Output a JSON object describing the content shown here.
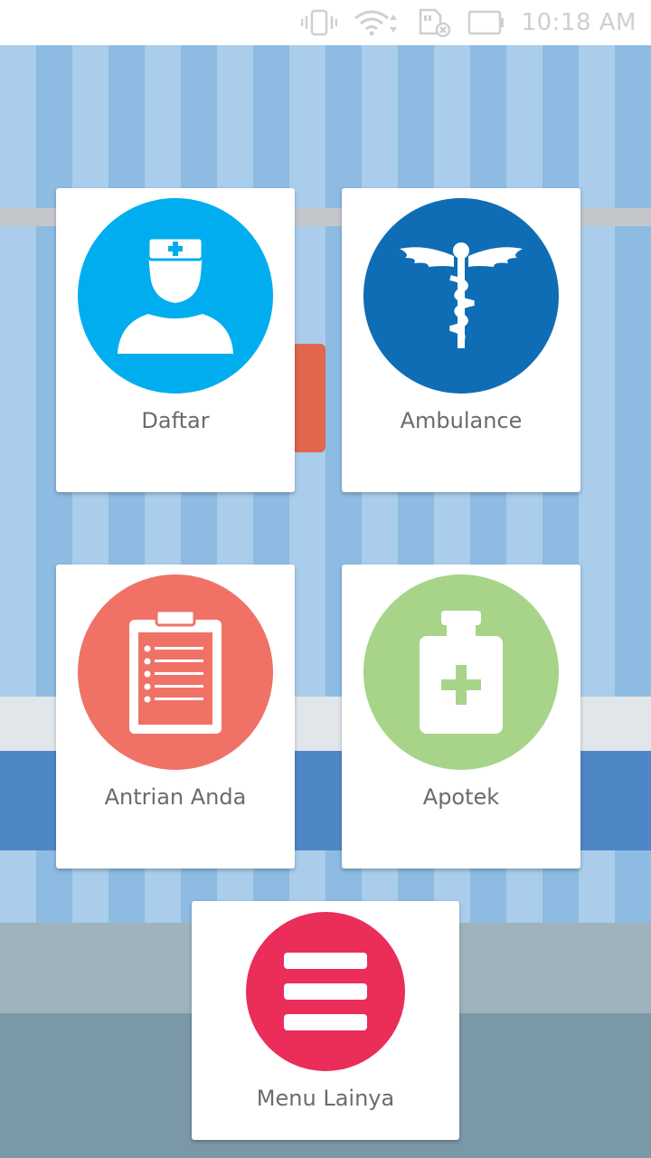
{
  "status_bar": {
    "time": "10:18 AM",
    "icons": [
      "vibrate-icon",
      "wifi-icon",
      "sim-card-off-icon",
      "battery-icon"
    ]
  },
  "menu": {
    "items": [
      {
        "label": "Daftar",
        "icon": "doctor-icon",
        "color": "#00aeef"
      },
      {
        "label": "Ambulance",
        "icon": "caduceus-icon",
        "color": "#0f6db5"
      },
      {
        "label": "Antrian Anda",
        "icon": "clipboard-icon",
        "color": "#f07267"
      },
      {
        "label": "Apotek",
        "icon": "medicine-bottle-icon",
        "color": "#a8d48a"
      },
      {
        "label": "Menu Lainya",
        "icon": "hamburger-menu-icon",
        "color": "#ea2d59"
      }
    ]
  }
}
